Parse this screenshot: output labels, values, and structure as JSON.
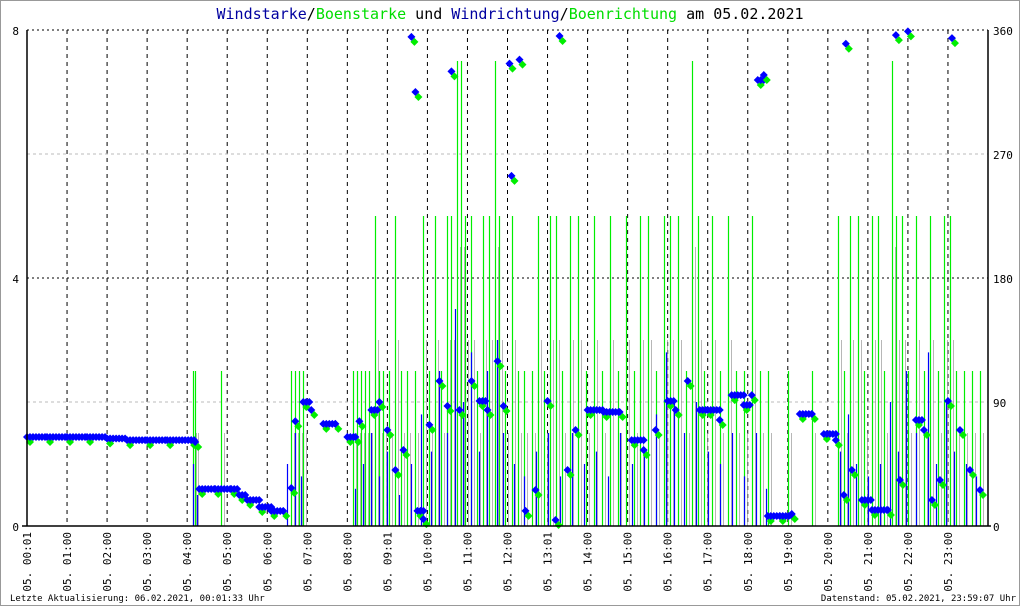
{
  "chart_data": {
    "type": "line",
    "title_parts": [
      {
        "text": "Windstarke",
        "color": "#0000a0"
      },
      {
        "text": "/",
        "color": "#000000"
      },
      {
        "text": "Boenstarke",
        "color": "#00dd00"
      },
      {
        "text": " und ",
        "color": "#000000"
      },
      {
        "text": "Windrichtung",
        "color": "#0000a0"
      },
      {
        "text": "/",
        "color": "#000000"
      },
      {
        "text": "Boenrichtung",
        "color": "#00dd00"
      },
      {
        "text": " am 05.02.2021",
        "color": "#000000"
      }
    ],
    "x_ticks": [
      "05. 00:01",
      "05. 01:00",
      "05. 02:00",
      "05. 03:00",
      "05. 04:00",
      "05. 05:00",
      "05. 06:00",
      "05. 07:00",
      "05. 08:00",
      "05. 09:01",
      "05. 10:00",
      "05. 11:00",
      "05. 12:00",
      "05. 13:01",
      "05. 14:00",
      "05. 15:00",
      "05. 16:00",
      "05. 17:00",
      "05. 18:00",
      "05. 19:00",
      "05. 20:00",
      "05. 21:00",
      "05. 22:00",
      "05. 23:00"
    ],
    "xlim_hours": [
      0,
      24
    ],
    "y_left": {
      "ticks": [
        "0",
        "4",
        "8"
      ],
      "range": [
        0,
        8
      ],
      "label": "Windstarke"
    },
    "y_right": {
      "ticks": [
        "0",
        "90",
        "180",
        "270",
        "360"
      ],
      "range": [
        0,
        360
      ],
      "label": "Windrichtung"
    },
    "colors": {
      "wind": "#0000ff",
      "gust": "#00ee00",
      "grid": "#000000",
      "subgrid": "#bbbbbb",
      "wind_thin": "#999999"
    },
    "gust_speed": [
      [
        4.15,
        2.5
      ],
      [
        4.2,
        2.5
      ],
      [
        4.85,
        2.5
      ],
      [
        6.6,
        2.5
      ],
      [
        6.7,
        2.5
      ],
      [
        6.8,
        2.5
      ],
      [
        6.9,
        2.5
      ],
      [
        8.15,
        2.5
      ],
      [
        8.25,
        2.5
      ],
      [
        8.35,
        2.5
      ],
      [
        8.45,
        2.5
      ],
      [
        8.55,
        2.5
      ],
      [
        8.7,
        5
      ],
      [
        8.8,
        2.5
      ],
      [
        8.9,
        2.5
      ],
      [
        9.05,
        2.5
      ],
      [
        9.2,
        5
      ],
      [
        9.35,
        2.5
      ],
      [
        9.5,
        2.5
      ],
      [
        9.7,
        2.5
      ],
      [
        9.9,
        5
      ],
      [
        10.05,
        2.5
      ],
      [
        10.2,
        5
      ],
      [
        10.35,
        2.5
      ],
      [
        10.5,
        5
      ],
      [
        10.6,
        5
      ],
      [
        10.75,
        7.5
      ],
      [
        10.85,
        7.5
      ],
      [
        10.95,
        5
      ],
      [
        11.1,
        5
      ],
      [
        11.25,
        2.5
      ],
      [
        11.4,
        5
      ],
      [
        11.55,
        5
      ],
      [
        11.7,
        7.5
      ],
      [
        11.8,
        5
      ],
      [
        11.95,
        2.5
      ],
      [
        12.1,
        5
      ],
      [
        12.25,
        2.5
      ],
      [
        12.4,
        2.5
      ],
      [
        12.6,
        2.5
      ],
      [
        12.75,
        5
      ],
      [
        12.9,
        2.5
      ],
      [
        13.05,
        5
      ],
      [
        13.2,
        5
      ],
      [
        13.35,
        2.5
      ],
      [
        13.55,
        5
      ],
      [
        13.75,
        5
      ],
      [
        13.95,
        2.5
      ],
      [
        14.15,
        5
      ],
      [
        14.35,
        2.5
      ],
      [
        14.55,
        5
      ],
      [
        14.75,
        2.5
      ],
      [
        14.95,
        5
      ],
      [
        15.15,
        2.5
      ],
      [
        15.3,
        5
      ],
      [
        15.5,
        5
      ],
      [
        15.7,
        2.5
      ],
      [
        15.9,
        5
      ],
      [
        16.05,
        5
      ],
      [
        16.25,
        5
      ],
      [
        16.45,
        2.5
      ],
      [
        16.6,
        7.5
      ],
      [
        16.75,
        5
      ],
      [
        16.9,
        2.5
      ],
      [
        17.1,
        5
      ],
      [
        17.3,
        2.5
      ],
      [
        17.5,
        5
      ],
      [
        17.7,
        2.5
      ],
      [
        17.9,
        2.5
      ],
      [
        18.1,
        5
      ],
      [
        18.3,
        2.5
      ],
      [
        18.5,
        2.5
      ],
      [
        19.0,
        2.5
      ],
      [
        19.6,
        2.5
      ],
      [
        20.25,
        5
      ],
      [
        20.4,
        2.5
      ],
      [
        20.55,
        5
      ],
      [
        20.75,
        5
      ],
      [
        20.9,
        2.5
      ],
      [
        21.1,
        5
      ],
      [
        21.25,
        5
      ],
      [
        21.4,
        2.5
      ],
      [
        21.6,
        7.5
      ],
      [
        21.7,
        5
      ],
      [
        21.85,
        5
      ],
      [
        22.0,
        2.5
      ],
      [
        22.2,
        5
      ],
      [
        22.4,
        2.5
      ],
      [
        22.55,
        5
      ],
      [
        22.75,
        2.5
      ],
      [
        22.9,
        5
      ],
      [
        23.05,
        5
      ],
      [
        23.2,
        2.5
      ],
      [
        23.4,
        2.5
      ],
      [
        23.6,
        2.5
      ],
      [
        23.8,
        2.5
      ]
    ],
    "wind_speed": [
      [
        4.15,
        1
      ],
      [
        4.25,
        0.5
      ],
      [
        6.5,
        1
      ],
      [
        6.7,
        1.5
      ],
      [
        6.85,
        0.8
      ],
      [
        8.2,
        0.6
      ],
      [
        8.4,
        1
      ],
      [
        8.6,
        1.5
      ],
      [
        8.8,
        0.8
      ],
      [
        9.0,
        1.2
      ],
      [
        9.3,
        0.5
      ],
      [
        9.6,
        1
      ],
      [
        9.85,
        1.8
      ],
      [
        10.1,
        1.2
      ],
      [
        10.3,
        2.5
      ],
      [
        10.5,
        1.5
      ],
      [
        10.7,
        3.5
      ],
      [
        10.9,
        2
      ],
      [
        11.1,
        2.8
      ],
      [
        11.3,
        1.2
      ],
      [
        11.5,
        2.5
      ],
      [
        11.75,
        3
      ],
      [
        11.9,
        1.5
      ],
      [
        12.15,
        1
      ],
      [
        12.4,
        0.8
      ],
      [
        12.7,
        1.2
      ],
      [
        13.0,
        1.5
      ],
      [
        13.3,
        0.8
      ],
      [
        13.6,
        1.5
      ],
      [
        13.9,
        1
      ],
      [
        14.2,
        1.2
      ],
      [
        14.5,
        0.8
      ],
      [
        14.8,
        1.5
      ],
      [
        15.1,
        1
      ],
      [
        15.4,
        1.2
      ],
      [
        15.7,
        1.8
      ],
      [
        15.95,
        2.8
      ],
      [
        16.15,
        2
      ],
      [
        16.4,
        1.5
      ],
      [
        16.7,
        2
      ],
      [
        17.0,
        1.2
      ],
      [
        17.3,
        1
      ],
      [
        17.6,
        1.5
      ],
      [
        17.9,
        0.8
      ],
      [
        18.2,
        1.5
      ],
      [
        18.45,
        0.6
      ],
      [
        20.3,
        1.2
      ],
      [
        20.5,
        1.8
      ],
      [
        20.7,
        1
      ],
      [
        21.0,
        0.8
      ],
      [
        21.3,
        1
      ],
      [
        21.55,
        2
      ],
      [
        21.75,
        1.2
      ],
      [
        21.95,
        2.5
      ],
      [
        22.2,
        1.5
      ],
      [
        22.5,
        2.8
      ],
      [
        22.7,
        1
      ],
      [
        22.95,
        2
      ],
      [
        23.15,
        1.2
      ],
      [
        23.45,
        1
      ],
      [
        23.7,
        0.8
      ]
    ],
    "wind_direction": [
      [
        0.0,
        64.6
      ],
      [
        0.5,
        64.6
      ],
      [
        1.0,
        64.6
      ],
      [
        1.5,
        64.6
      ],
      [
        2.0,
        63.5
      ],
      [
        2.5,
        62.3
      ],
      [
        3.0,
        62.3
      ],
      [
        3.5,
        62.3
      ],
      [
        4.1,
        62.3
      ],
      [
        4.2,
        61
      ],
      [
        4.3,
        26.9
      ],
      [
        4.7,
        26.9
      ],
      [
        5.1,
        26.9
      ],
      [
        5.3,
        22.5
      ],
      [
        5.5,
        18.9
      ],
      [
        5.8,
        13.8
      ],
      [
        6.1,
        10.9
      ],
      [
        6.4,
        10.9
      ],
      [
        6.6,
        27.6
      ],
      [
        6.7,
        76
      ],
      [
        6.9,
        90
      ],
      [
        7.1,
        84.2
      ],
      [
        7.4,
        74.1
      ],
      [
        7.7,
        74.1
      ],
      [
        8.0,
        64.6
      ],
      [
        8.2,
        64.6
      ],
      [
        8.3,
        76
      ],
      [
        8.6,
        84.2
      ],
      [
        8.8,
        90
      ],
      [
        9.0,
        69.7
      ],
      [
        9.2,
        40.6
      ],
      [
        9.4,
        55.2
      ],
      [
        9.6,
        355
      ],
      [
        9.7,
        315
      ],
      [
        9.75,
        11
      ],
      [
        9.9,
        5
      ],
      [
        10.05,
        73.4
      ],
      [
        10.3,
        105.2
      ],
      [
        10.5,
        87.1
      ],
      [
        10.6,
        330
      ],
      [
        10.8,
        84.2
      ],
      [
        11.1,
        105.2
      ],
      [
        11.3,
        90.7
      ],
      [
        11.5,
        84.2
      ],
      [
        11.75,
        119.7
      ],
      [
        11.9,
        87.1
      ],
      [
        12.05,
        335.6
      ],
      [
        12.1,
        254.1
      ],
      [
        12.3,
        338.5
      ],
      [
        12.45,
        11
      ],
      [
        12.7,
        26.1
      ],
      [
        13.0,
        90.7
      ],
      [
        13.2,
        4.4
      ],
      [
        13.3,
        355.6
      ],
      [
        13.5,
        40.6
      ],
      [
        13.7,
        69.7
      ],
      [
        14.0,
        84.2
      ],
      [
        14.4,
        82.7
      ],
      [
        14.8,
        82.7
      ],
      [
        15.1,
        62.3
      ],
      [
        15.4,
        55.2
      ],
      [
        15.7,
        69.7
      ],
      [
        16.0,
        90.7
      ],
      [
        16.2,
        84.2
      ],
      [
        16.5,
        105.2
      ],
      [
        16.8,
        84.2
      ],
      [
        17.0,
        84.2
      ],
      [
        17.3,
        76.9
      ],
      [
        17.6,
        95
      ],
      [
        17.9,
        87.8
      ],
      [
        18.1,
        95
      ],
      [
        18.25,
        323.7
      ],
      [
        18.4,
        327.3
      ],
      [
        18.5,
        7.3
      ],
      [
        18.8,
        7.3
      ],
      [
        19.1,
        8.7
      ],
      [
        19.3,
        81.3
      ],
      [
        19.6,
        81.3
      ],
      [
        19.9,
        66.8
      ],
      [
        20.2,
        62.3
      ],
      [
        20.4,
        22.5
      ],
      [
        20.45,
        350
      ],
      [
        20.6,
        40.6
      ],
      [
        20.85,
        18.9
      ],
      [
        21.1,
        11.6
      ],
      [
        21.5,
        11.6
      ],
      [
        21.7,
        356.3
      ],
      [
        21.8,
        33.4
      ],
      [
        22.0,
        359
      ],
      [
        22.2,
        76.9
      ],
      [
        22.4,
        69.7
      ],
      [
        22.6,
        18.9
      ],
      [
        22.8,
        33.4
      ],
      [
        23.0,
        90.7
      ],
      [
        23.1,
        354.1
      ],
      [
        23.3,
        69.7
      ],
      [
        23.55,
        40.6
      ],
      [
        23.8,
        26.1
      ]
    ],
    "grid": true,
    "legend": "title"
  },
  "footer": {
    "left": "Letzte Aktualisierung: 06.02.2021, 00:01:33 Uhr",
    "right": "Datenstand: 05.02.2021, 23:59:07 Uhr"
  }
}
